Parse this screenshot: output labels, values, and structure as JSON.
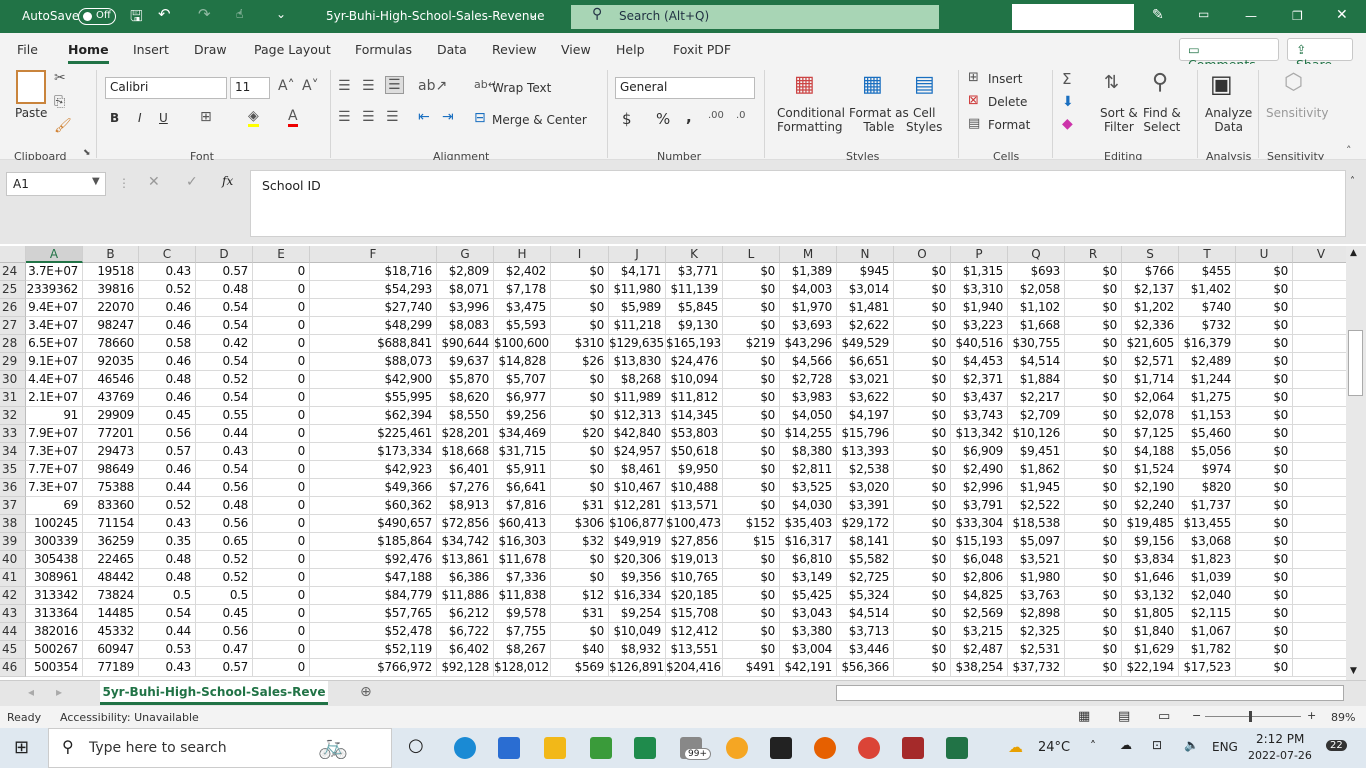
{
  "titlebar": {
    "autosave_label": "AutoSave",
    "autosave_state": "Off",
    "filename": "5yr-Buhi-High-School-Sales-Revenue",
    "search_placeholder": "Search (Alt+Q)"
  },
  "tabs": [
    "File",
    "Home",
    "Insert",
    "Draw",
    "Page Layout",
    "Formulas",
    "Data",
    "Review",
    "View",
    "Help",
    "Foxit PDF"
  ],
  "active_tab": "Home",
  "comments_label": "Comments",
  "share_label": "Share",
  "ribbon": {
    "paste": "Paste",
    "font_name": "Calibri",
    "font_size": "11",
    "bold": "B",
    "italic": "I",
    "underline": "U",
    "wrap_text": "Wrap Text",
    "merge_center": "Merge & Center",
    "number_format": "General",
    "currency": "$",
    "percent": "%",
    "comma": ",",
    "conditional_formatting": [
      "Conditional",
      "Formatting"
    ],
    "format_as_table": [
      "Format as",
      "Table"
    ],
    "cell_styles": [
      "Cell",
      "Styles"
    ],
    "insert": "Insert",
    "delete": "Delete",
    "format": "Format",
    "sort_filter": [
      "Sort &",
      "Filter"
    ],
    "find_select": [
      "Find &",
      "Select"
    ],
    "analyze_data": [
      "Analyze",
      "Data"
    ],
    "sensitivity": "Sensitivity",
    "groups": [
      "Clipboard",
      "Font",
      "Alignment",
      "Number",
      "Styles",
      "Cells",
      "Editing",
      "Analysis",
      "Sensitivity"
    ]
  },
  "formula_bar": {
    "name_box": "A1",
    "fx": "fx",
    "content": "School ID"
  },
  "columns": [
    "A",
    "B",
    "C",
    "D",
    "E",
    "F",
    "G",
    "H",
    "I",
    "J",
    "K",
    "L",
    "M",
    "N",
    "O",
    "P",
    "Q",
    "R",
    "S",
    "T",
    "U",
    "V"
  ],
  "row_numbers": [
    24,
    25,
    26,
    27,
    28,
    29,
    30,
    31,
    32,
    33,
    34,
    35,
    36,
    37,
    38,
    39,
    40,
    41,
    42,
    43,
    44,
    45,
    46
  ],
  "rows": [
    [
      "3.7E+07",
      "19518",
      "0.43",
      "0.57",
      "0",
      "$18,716",
      "$2,809",
      "$2,402",
      "$0",
      "$4,171",
      "$3,771",
      "$0",
      "$1,389",
      "$945",
      "$0",
      "$1,315",
      "$693",
      "$0",
      "$766",
      "$455",
      "$0"
    ],
    [
      "2339362",
      "39816",
      "0.52",
      "0.48",
      "0",
      "$54,293",
      "$8,071",
      "$7,178",
      "$0",
      "$11,980",
      "$11,139",
      "$0",
      "$4,003",
      "$3,014",
      "$0",
      "$3,310",
      "$2,058",
      "$0",
      "$2,137",
      "$1,402",
      "$0"
    ],
    [
      "9.4E+07",
      "22070",
      "0.46",
      "0.54",
      "0",
      "$27,740",
      "$3,996",
      "$3,475",
      "$0",
      "$5,989",
      "$5,845",
      "$0",
      "$1,970",
      "$1,481",
      "$0",
      "$1,940",
      "$1,102",
      "$0",
      "$1,202",
      "$740",
      "$0"
    ],
    [
      "3.4E+07",
      "98247",
      "0.46",
      "0.54",
      "0",
      "$48,299",
      "$8,083",
      "$5,593",
      "$0",
      "$11,218",
      "$9,130",
      "$0",
      "$3,693",
      "$2,622",
      "$0",
      "$3,223",
      "$1,668",
      "$0",
      "$2,336",
      "$732",
      "$0"
    ],
    [
      "6.5E+07",
      "78660",
      "0.58",
      "0.42",
      "0",
      "$688,841",
      "$90,644",
      "$100,600",
      "$310",
      "$129,635",
      "$165,193",
      "$219",
      "$43,296",
      "$49,529",
      "$0",
      "$40,516",
      "$30,755",
      "$0",
      "$21,605",
      "$16,379",
      "$0"
    ],
    [
      "9.1E+07",
      "92035",
      "0.46",
      "0.54",
      "0",
      "$88,073",
      "$9,637",
      "$14,828",
      "$26",
      "$13,830",
      "$24,476",
      "$0",
      "$4,566",
      "$6,651",
      "$0",
      "$4,453",
      "$4,514",
      "$0",
      "$2,571",
      "$2,489",
      "$0"
    ],
    [
      "4.4E+07",
      "46546",
      "0.48",
      "0.52",
      "0",
      "$42,900",
      "$5,870",
      "$5,707",
      "$0",
      "$8,268",
      "$10,094",
      "$0",
      "$2,728",
      "$3,021",
      "$0",
      "$2,371",
      "$1,884",
      "$0",
      "$1,714",
      "$1,244",
      "$0"
    ],
    [
      "2.1E+07",
      "43769",
      "0.46",
      "0.54",
      "0",
      "$55,995",
      "$8,620",
      "$6,977",
      "$0",
      "$11,989",
      "$11,812",
      "$0",
      "$3,983",
      "$3,622",
      "$0",
      "$3,437",
      "$2,217",
      "$0",
      "$2,064",
      "$1,275",
      "$0"
    ],
    [
      "91",
      "29909",
      "0.45",
      "0.55",
      "0",
      "$62,394",
      "$8,550",
      "$9,256",
      "$0",
      "$12,313",
      "$14,345",
      "$0",
      "$4,050",
      "$4,197",
      "$0",
      "$3,743",
      "$2,709",
      "$0",
      "$2,078",
      "$1,153",
      "$0"
    ],
    [
      "7.9E+07",
      "77201",
      "0.56",
      "0.44",
      "0",
      "$225,461",
      "$28,201",
      "$34,469",
      "$20",
      "$42,840",
      "$53,803",
      "$0",
      "$14,255",
      "$15,796",
      "$0",
      "$13,342",
      "$10,126",
      "$0",
      "$7,125",
      "$5,460",
      "$0"
    ],
    [
      "7.3E+07",
      "29473",
      "0.57",
      "0.43",
      "0",
      "$173,334",
      "$18,668",
      "$31,715",
      "$0",
      "$24,957",
      "$50,618",
      "$0",
      "$8,380",
      "$13,393",
      "$0",
      "$6,909",
      "$9,451",
      "$0",
      "$4,188",
      "$5,056",
      "$0"
    ],
    [
      "7.7E+07",
      "98649",
      "0.46",
      "0.54",
      "0",
      "$42,923",
      "$6,401",
      "$5,911",
      "$0",
      "$8,461",
      "$9,950",
      "$0",
      "$2,811",
      "$2,538",
      "$0",
      "$2,490",
      "$1,862",
      "$0",
      "$1,524",
      "$974",
      "$0"
    ],
    [
      "7.3E+07",
      "75388",
      "0.44",
      "0.56",
      "0",
      "$49,366",
      "$7,276",
      "$6,641",
      "$0",
      "$10,467",
      "$10,488",
      "$0",
      "$3,525",
      "$3,020",
      "$0",
      "$2,996",
      "$1,945",
      "$0",
      "$2,190",
      "$820",
      "$0"
    ],
    [
      "69",
      "83360",
      "0.52",
      "0.48",
      "0",
      "$60,362",
      "$8,913",
      "$7,816",
      "$31",
      "$12,281",
      "$13,571",
      "$0",
      "$4,030",
      "$3,391",
      "$0",
      "$3,791",
      "$2,522",
      "$0",
      "$2,240",
      "$1,737",
      "$0"
    ],
    [
      "100245",
      "71154",
      "0.43",
      "0.56",
      "0",
      "$490,657",
      "$72,856",
      "$60,413",
      "$306",
      "$106,877",
      "$100,473",
      "$152",
      "$35,403",
      "$29,172",
      "$0",
      "$33,304",
      "$18,538",
      "$0",
      "$19,485",
      "$13,455",
      "$0"
    ],
    [
      "300339",
      "36259",
      "0.35",
      "0.65",
      "0",
      "$185,864",
      "$34,742",
      "$16,303",
      "$32",
      "$49,919",
      "$27,856",
      "$15",
      "$16,317",
      "$8,141",
      "$0",
      "$15,193",
      "$5,097",
      "$0",
      "$9,156",
      "$3,068",
      "$0"
    ],
    [
      "305438",
      "22465",
      "0.48",
      "0.52",
      "0",
      "$92,476",
      "$13,861",
      "$11,678",
      "$0",
      "$20,306",
      "$19,013",
      "$0",
      "$6,810",
      "$5,582",
      "$0",
      "$6,048",
      "$3,521",
      "$0",
      "$3,834",
      "$1,823",
      "$0"
    ],
    [
      "308961",
      "48442",
      "0.48",
      "0.52",
      "0",
      "$47,188",
      "$6,386",
      "$7,336",
      "$0",
      "$9,356",
      "$10,765",
      "$0",
      "$3,149",
      "$2,725",
      "$0",
      "$2,806",
      "$1,980",
      "$0",
      "$1,646",
      "$1,039",
      "$0"
    ],
    [
      "313342",
      "73824",
      "0.5",
      "0.5",
      "0",
      "$84,779",
      "$11,886",
      "$11,838",
      "$12",
      "$16,334",
      "$20,185",
      "$0",
      "$5,425",
      "$5,324",
      "$0",
      "$4,825",
      "$3,763",
      "$0",
      "$3,132",
      "$2,040",
      "$0"
    ],
    [
      "313364",
      "14485",
      "0.54",
      "0.45",
      "0",
      "$57,765",
      "$6,212",
      "$9,578",
      "$31",
      "$9,254",
      "$15,708",
      "$0",
      "$3,043",
      "$4,514",
      "$0",
      "$2,569",
      "$2,898",
      "$0",
      "$1,805",
      "$2,115",
      "$0"
    ],
    [
      "382016",
      "45332",
      "0.44",
      "0.56",
      "0",
      "$52,478",
      "$6,722",
      "$7,755",
      "$0",
      "$10,049",
      "$12,412",
      "$0",
      "$3,380",
      "$3,713",
      "$0",
      "$3,215",
      "$2,325",
      "$0",
      "$1,840",
      "$1,067",
      "$0"
    ],
    [
      "500267",
      "60947",
      "0.53",
      "0.47",
      "0",
      "$52,119",
      "$6,402",
      "$8,267",
      "$40",
      "$8,932",
      "$13,551",
      "$0",
      "$3,004",
      "$3,446",
      "$0",
      "$2,487",
      "$2,531",
      "$0",
      "$1,629",
      "$1,782",
      "$0"
    ],
    [
      "500354",
      "77189",
      "0.43",
      "0.57",
      "0",
      "$766,972",
      "$92,128",
      "$128,012",
      "$569",
      "$126,891",
      "$204,416",
      "$491",
      "$42,191",
      "$56,366",
      "$0",
      "$38,254",
      "$37,732",
      "$0",
      "$22,194",
      "$17,523",
      "$0"
    ]
  ],
  "sheet_tab": "5yr-Buhi-High-School-Sales-Reve",
  "status": {
    "ready": "Ready",
    "accessibility": "Accessibility: Unavailable",
    "zoom": "89%",
    "zoom_level": 89
  },
  "taskbar": {
    "search_placeholder": "Type here to search",
    "mail_badge": "99+",
    "weather": "24°C",
    "language": "ENG",
    "time": "2:12 PM",
    "date": "2022-07-26",
    "notifications": "22"
  },
  "colors": {
    "accent": "#217346",
    "search_bg": "#a8d5b5"
  }
}
